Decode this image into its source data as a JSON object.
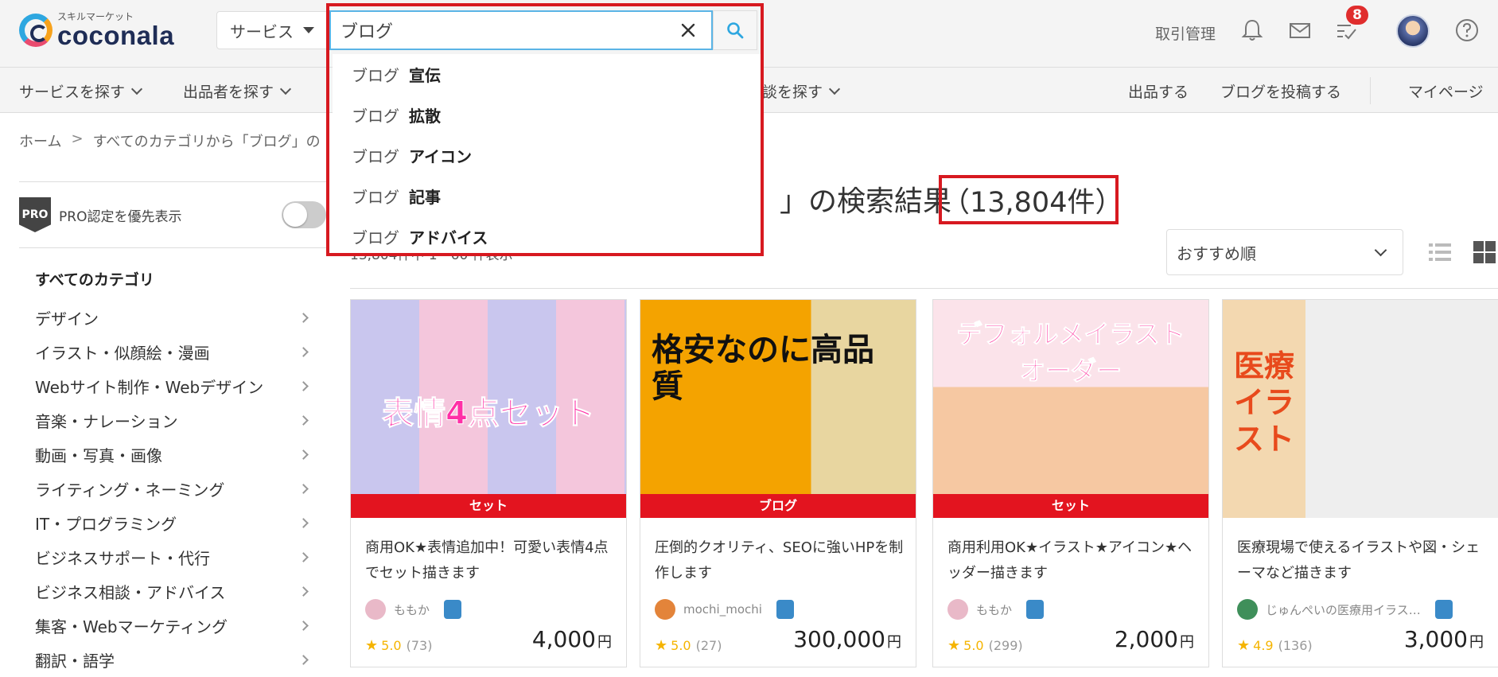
{
  "header": {
    "logo_sub": "スキルマーケット",
    "logo_main": "coconala",
    "service_select": "サービス",
    "search_value": "ブログ",
    "nav_transaction": "取引管理",
    "notification_count": "8"
  },
  "suggestions": [
    "宣伝",
    "拡散",
    "アイコン",
    "記事",
    "アドバイス"
  ],
  "suggest_prefix": "ブログ",
  "subnav": {
    "find_service": "サービスを探す",
    "find_seller": "出品者を探す",
    "find_consult": "談を探す",
    "sell": "出品する",
    "post_blog": "ブログを投稿する",
    "mypage": "マイページ"
  },
  "breadcrumb": {
    "home": "ホーム",
    "current": "すべてのカテゴリから「ブログ」の"
  },
  "sidebar": {
    "pro_label": "PRO認定を優先表示",
    "all_categories": "すべてのカテゴリ",
    "categories": [
      "デザイン",
      "イラスト・似顔絵・漫画",
      "Webサイト制作・Webデザイン",
      "音楽・ナレーション",
      "動画・写真・画像",
      "ライティング・ネーミング",
      "IT・プログラミング",
      "ビジネスサポート・代行",
      "ビジネス相談・アドバイス",
      "集客・Webマーケティング",
      "翻訳・語学"
    ]
  },
  "results": {
    "title_suffix": "」の検索結果",
    "count": "（13,804件）",
    "summary": "13,804件中 1 - 60 件表示",
    "sort": "おすすめ順"
  },
  "cards": [
    {
      "band": "セット",
      "thumb_text": "表情4点セット",
      "title": "商用OK★表情追加中！可愛い表情4点でセット描きます",
      "seller": "ももか",
      "rating": "5.0",
      "reviews": "(73)",
      "price": "4,000",
      "unit": "円"
    },
    {
      "band": "ブログ",
      "thumb_text": "格安なのに高品質",
      "title": "圧倒的クオリティ、SEOに強いHPを制作します",
      "seller": "mochi_mochi",
      "rating": "5.0",
      "reviews": "(27)",
      "price": "300,000",
      "unit": "円"
    },
    {
      "band": "セット",
      "thumb_text": "デフォルメイラストオーダー",
      "title": "商用利用OK★イラスト★アイコン★ヘッダー描きます",
      "seller": "ももか",
      "rating": "5.0",
      "reviews": "(299)",
      "price": "2,000",
      "unit": "円"
    },
    {
      "band": "",
      "thumb_text": "医療イラスト",
      "title": "医療現場で使えるイラストや図・シェーマなど描きます",
      "seller": "じゅんぺいの医療用イラス…",
      "rating": "4.9",
      "reviews": "(136)",
      "price": "3,000",
      "unit": "円"
    }
  ],
  "colors": {
    "accent_blue": "#2ea7e0",
    "highlight_red": "#d71920",
    "band_red": "#e3141f",
    "star": "#f5b400"
  }
}
